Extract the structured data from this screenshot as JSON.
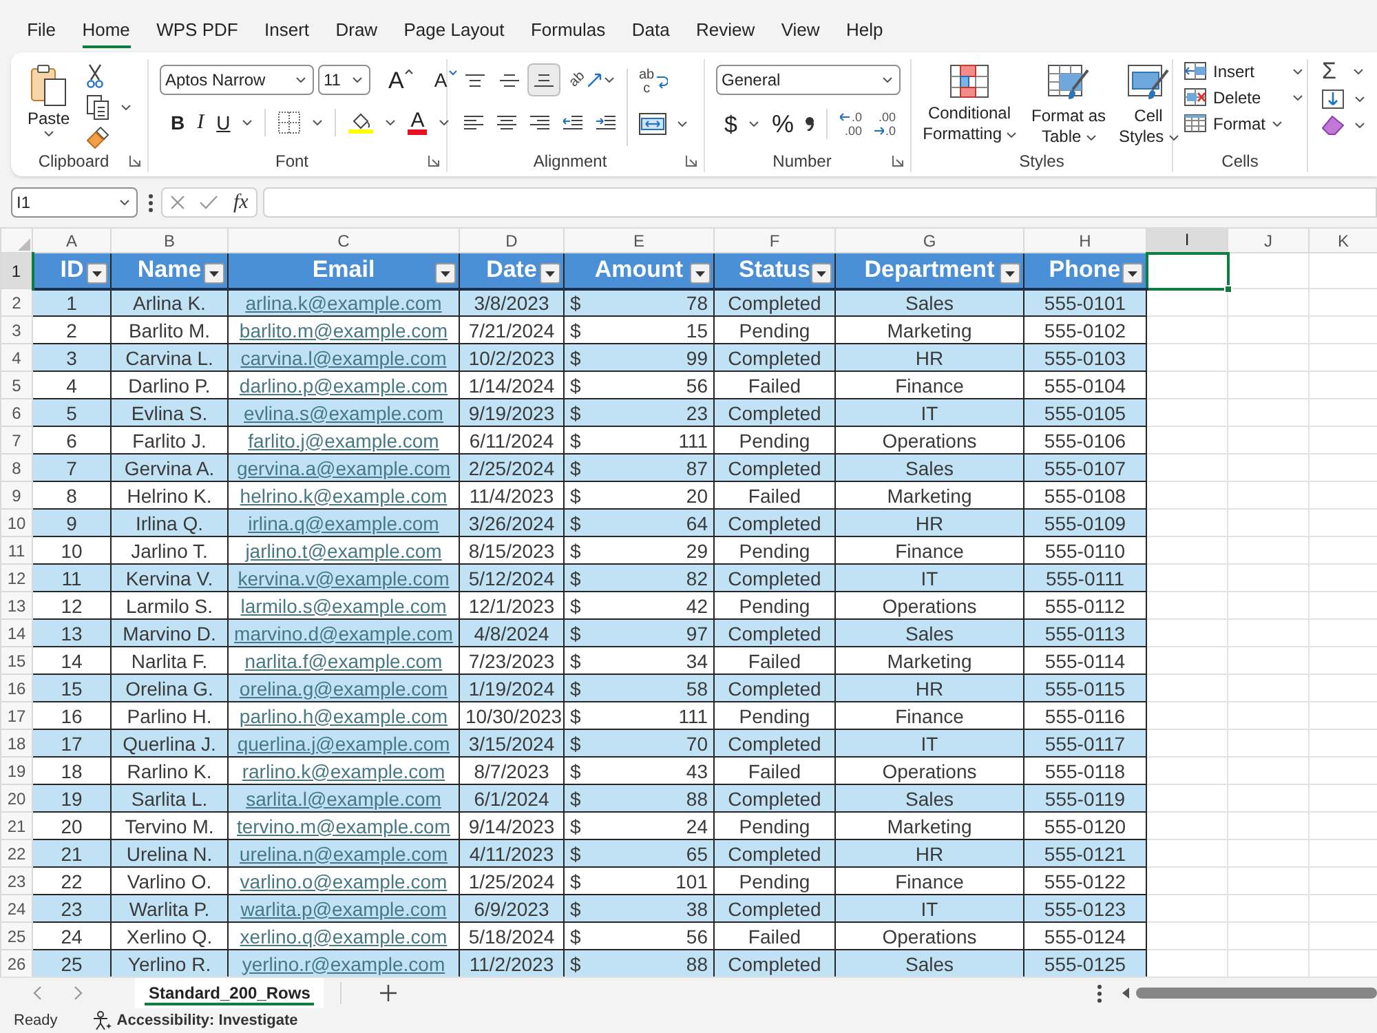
{
  "menu_tabs": [
    {
      "label": "File",
      "selected": false
    },
    {
      "label": "Home",
      "selected": true
    },
    {
      "label": "WPS PDF",
      "selected": false
    },
    {
      "label": "Insert",
      "selected": false
    },
    {
      "label": "Draw",
      "selected": false
    },
    {
      "label": "Page Layout",
      "selected": false
    },
    {
      "label": "Formulas",
      "selected": false
    },
    {
      "label": "Data",
      "selected": false
    },
    {
      "label": "Review",
      "selected": false
    },
    {
      "label": "View",
      "selected": false
    },
    {
      "label": "Help",
      "selected": false
    }
  ],
  "ribbon": {
    "clipboard": {
      "label": "Clipboard",
      "paste": "Paste"
    },
    "font": {
      "label": "Font",
      "font_name": "Aptos Narrow",
      "font_size": "11",
      "grow_font": "A",
      "shrink_font": "A",
      "bold": "B",
      "italic": "I",
      "underline": "U",
      "font_color": "A"
    },
    "alignment": {
      "label": "Alignment",
      "vertical": [
        {
          "kind": "top",
          "selected": false
        },
        {
          "kind": "middle",
          "selected": false
        },
        {
          "kind": "bottom",
          "selected": true
        }
      ],
      "orientation": "ab",
      "wrap_text": [
        "ab",
        "c"
      ]
    },
    "number": {
      "label": "Number",
      "format": "General",
      "currency": "$",
      "percent": "%",
      "decimals": [
        {
          "kind": "increase",
          "lines": [
            ".0",
            ".00"
          ]
        },
        {
          "kind": "decrease",
          "lines": [
            ".00",
            ".0"
          ]
        }
      ]
    },
    "styles": {
      "label": "Styles",
      "buttons": [
        {
          "kind": "conditional",
          "label": "Conditional Formatting"
        },
        {
          "kind": "table",
          "label": "Format as Table"
        },
        {
          "kind": "cell",
          "label": "Cell Styles"
        }
      ]
    },
    "cells": {
      "label": "Cells",
      "buttons": [
        {
          "kind": "insert",
          "label": "Insert"
        },
        {
          "kind": "delete",
          "label": "Delete"
        },
        {
          "kind": "format",
          "label": "Format"
        }
      ]
    },
    "editing": {
      "autosum": "Σ"
    }
  },
  "formula_bar": {
    "name_box": "I1",
    "function_label": "fx"
  },
  "sheet": {
    "columns": [
      {
        "label": "A",
        "selected": false
      },
      {
        "label": "B",
        "selected": false
      },
      {
        "label": "C",
        "selected": false
      },
      {
        "label": "D",
        "selected": false
      },
      {
        "label": "E",
        "selected": false
      },
      {
        "label": "F",
        "selected": false
      },
      {
        "label": "G",
        "selected": false
      },
      {
        "label": "H",
        "selected": false
      },
      {
        "label": "I",
        "selected": true
      },
      {
        "label": "J",
        "selected": false
      },
      {
        "label": "K",
        "selected": false
      }
    ],
    "header_row": {
      "number": "1",
      "selected": true,
      "titles": [
        "ID",
        "Name",
        "Email",
        "Date",
        "Amount",
        "Status",
        "Department",
        "Phone"
      ]
    },
    "rows": [
      {
        "number": "2",
        "selected": false,
        "id": "1",
        "name": "Arlina K.",
        "email": "arlina.k@example.com",
        "date": "3/8/2023",
        "currency": "$",
        "amount": "78",
        "status": "Completed",
        "department": "Sales",
        "phone": "555-0101"
      },
      {
        "number": "3",
        "selected": false,
        "id": "2",
        "name": "Barlito M.",
        "email": "barlito.m@example.com",
        "date": "7/21/2024",
        "currency": "$",
        "amount": "15",
        "status": "Pending",
        "department": "Marketing",
        "phone": "555-0102"
      },
      {
        "number": "4",
        "selected": false,
        "id": "3",
        "name": "Carvina L.",
        "email": "carvina.l@example.com",
        "date": "10/2/2023",
        "currency": "$",
        "amount": "99",
        "status": "Completed",
        "department": "HR",
        "phone": "555-0103"
      },
      {
        "number": "5",
        "selected": false,
        "id": "4",
        "name": "Darlino P.",
        "email": "darlino.p@example.com",
        "date": "1/14/2024",
        "currency": "$",
        "amount": "56",
        "status": "Failed",
        "department": "Finance",
        "phone": "555-0104"
      },
      {
        "number": "6",
        "selected": false,
        "id": "5",
        "name": "Evlina S.",
        "email": "evlina.s@example.com",
        "date": "9/19/2023",
        "currency": "$",
        "amount": "23",
        "status": "Completed",
        "department": "IT",
        "phone": "555-0105"
      },
      {
        "number": "7",
        "selected": false,
        "id": "6",
        "name": "Farlito J.",
        "email": "farlito.j@example.com",
        "date": "6/11/2024",
        "currency": "$",
        "amount": "111",
        "status": "Pending",
        "department": "Operations",
        "phone": "555-0106"
      },
      {
        "number": "8",
        "selected": false,
        "id": "7",
        "name": "Gervina A.",
        "email": "gervina.a@example.com",
        "date": "2/25/2024",
        "currency": "$",
        "amount": "87",
        "status": "Completed",
        "department": "Sales",
        "phone": "555-0107"
      },
      {
        "number": "9",
        "selected": false,
        "id": "8",
        "name": "Helrino K.",
        "email": "helrino.k@example.com",
        "date": "11/4/2023",
        "currency": "$",
        "amount": "20",
        "status": "Failed",
        "department": "Marketing",
        "phone": "555-0108"
      },
      {
        "number": "10",
        "selected": false,
        "id": "9",
        "name": "Irlina Q.",
        "email": "irlina.q@example.com",
        "date": "3/26/2024",
        "currency": "$",
        "amount": "64",
        "status": "Completed",
        "department": "HR",
        "phone": "555-0109"
      },
      {
        "number": "11",
        "selected": false,
        "id": "10",
        "name": "Jarlino T.",
        "email": "jarlino.t@example.com",
        "date": "8/15/2023",
        "currency": "$",
        "amount": "29",
        "status": "Pending",
        "department": "Finance",
        "phone": "555-0110"
      },
      {
        "number": "12",
        "selected": false,
        "id": "11",
        "name": "Kervina V.",
        "email": "kervina.v@example.com",
        "date": "5/12/2024",
        "currency": "$",
        "amount": "82",
        "status": "Completed",
        "department": "IT",
        "phone": "555-0111"
      },
      {
        "number": "13",
        "selected": false,
        "id": "12",
        "name": "Larmilo S.",
        "email": "larmilo.s@example.com",
        "date": "12/1/2023",
        "currency": "$",
        "amount": "42",
        "status": "Pending",
        "department": "Operations",
        "phone": "555-0112"
      },
      {
        "number": "14",
        "selected": false,
        "id": "13",
        "name": "Marvino D.",
        "email": "marvino.d@example.com",
        "date": "4/8/2024",
        "currency": "$",
        "amount": "97",
        "status": "Completed",
        "department": "Sales",
        "phone": "555-0113"
      },
      {
        "number": "15",
        "selected": false,
        "id": "14",
        "name": "Narlita F.",
        "email": "narlita.f@example.com",
        "date": "7/23/2023",
        "currency": "$",
        "amount": "34",
        "status": "Failed",
        "department": "Marketing",
        "phone": "555-0114"
      },
      {
        "number": "16",
        "selected": false,
        "id": "15",
        "name": "Orelina G.",
        "email": "orelina.g@example.com",
        "date": "1/19/2024",
        "currency": "$",
        "amount": "58",
        "status": "Completed",
        "department": "HR",
        "phone": "555-0115"
      },
      {
        "number": "17",
        "selected": false,
        "id": "16",
        "name": "Parlino H.",
        "email": "parlino.h@example.com",
        "date": "10/30/2023",
        "currency": "$",
        "amount": "111",
        "status": "Pending",
        "department": "Finance",
        "phone": "555-0116"
      },
      {
        "number": "18",
        "selected": false,
        "id": "17",
        "name": "Querlina J.",
        "email": "querlina.j@example.com",
        "date": "3/15/2024",
        "currency": "$",
        "amount": "70",
        "status": "Completed",
        "department": "IT",
        "phone": "555-0117"
      },
      {
        "number": "19",
        "selected": false,
        "id": "18",
        "name": "Rarlino K.",
        "email": "rarlino.k@example.com",
        "date": "8/7/2023",
        "currency": "$",
        "amount": "43",
        "status": "Failed",
        "department": "Operations",
        "phone": "555-0118"
      },
      {
        "number": "20",
        "selected": false,
        "id": "19",
        "name": "Sarlita L.",
        "email": "sarlita.l@example.com",
        "date": "6/1/2024",
        "currency": "$",
        "amount": "88",
        "status": "Completed",
        "department": "Sales",
        "phone": "555-0119"
      },
      {
        "number": "21",
        "selected": false,
        "id": "20",
        "name": "Tervino M.",
        "email": "tervino.m@example.com",
        "date": "9/14/2023",
        "currency": "$",
        "amount": "24",
        "status": "Pending",
        "department": "Marketing",
        "phone": "555-0120"
      },
      {
        "number": "22",
        "selected": false,
        "id": "21",
        "name": "Urelina N.",
        "email": "urelina.n@example.com",
        "date": "4/11/2023",
        "currency": "$",
        "amount": "65",
        "status": "Completed",
        "department": "HR",
        "phone": "555-0121"
      },
      {
        "number": "23",
        "selected": false,
        "id": "22",
        "name": "Varlino O.",
        "email": "varlino.o@example.com",
        "date": "1/25/2024",
        "currency": "$",
        "amount": "101",
        "status": "Pending",
        "department": "Finance",
        "phone": "555-0122"
      },
      {
        "number": "24",
        "selected": false,
        "id": "23",
        "name": "Warlita P.",
        "email": "warlita.p@example.com",
        "date": "6/9/2023",
        "currency": "$",
        "amount": "38",
        "status": "Completed",
        "department": "IT",
        "phone": "555-0123"
      },
      {
        "number": "25",
        "selected": false,
        "id": "24",
        "name": "Xerlino Q.",
        "email": "xerlino.q@example.com",
        "date": "5/18/2024",
        "currency": "$",
        "amount": "56",
        "status": "Failed",
        "department": "Operations",
        "phone": "555-0124"
      },
      {
        "number": "26",
        "selected": false,
        "id": "25",
        "name": "Yerlino R.",
        "email": "yerlino.r@example.com",
        "date": "11/2/2023",
        "currency": "$",
        "amount": "88",
        "status": "Completed",
        "department": "Sales",
        "phone": "555-0125"
      }
    ]
  },
  "sheet_tabs": [
    {
      "label": "Standard_200_Rows",
      "selected": true
    }
  ],
  "status_bar": {
    "mode": "Ready",
    "accessibility": "Accessibility: Investigate"
  }
}
